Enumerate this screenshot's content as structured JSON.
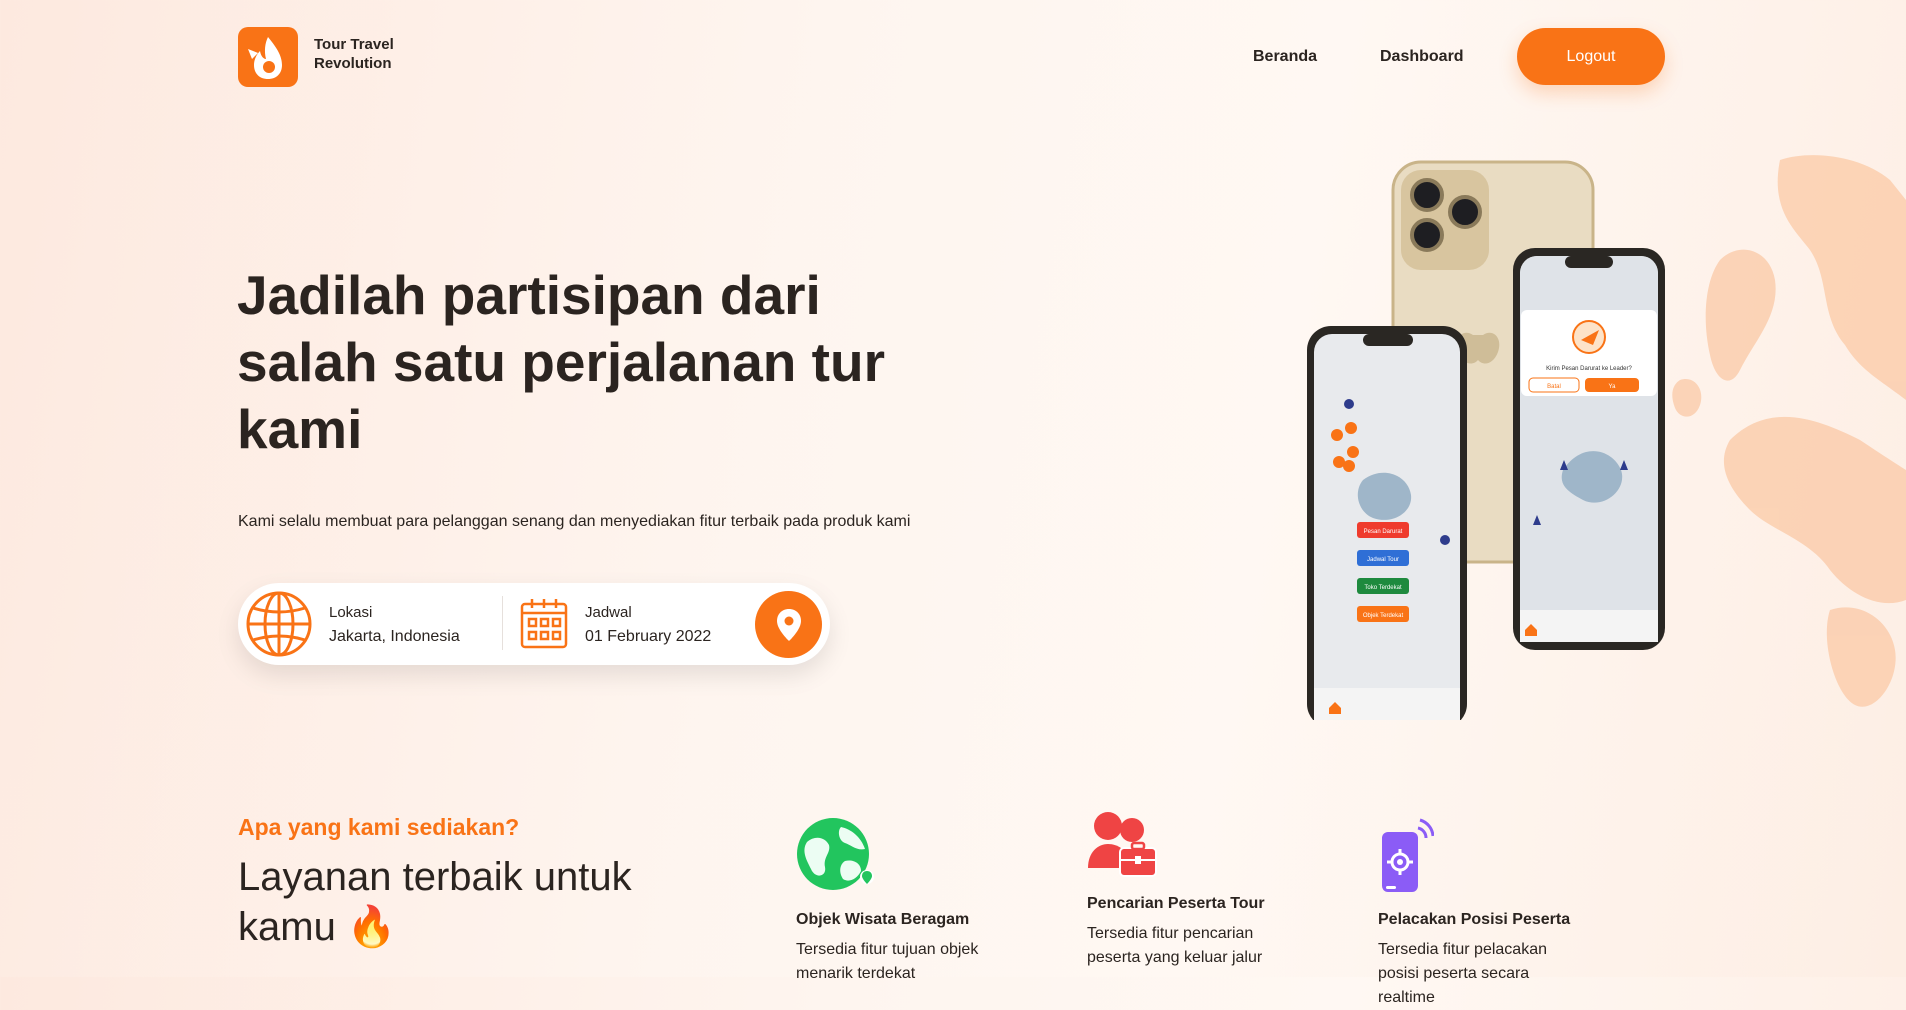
{
  "brand": {
    "line1": "Tour Travel",
    "line2": "Revolution"
  },
  "nav": {
    "beranda": "Beranda",
    "dashboard": "Dashboard",
    "logout": "Logout"
  },
  "hero": {
    "title": "Jadilah partisipan dari salah satu perjalanan tur kami",
    "subtitle": "Kami selalu membuat para pelanggan senang dan menyediakan fitur terbaik pada produk kami"
  },
  "search": {
    "location_label": "Lokasi",
    "location_value": "Jakarta, Indonesia",
    "schedule_label": "Jadwal",
    "schedule_value": "01 February 2022"
  },
  "phone_screens": {
    "dialog_text": "Kirim Pesan Darurat ke Leader?",
    "dialog_cancel": "Batal",
    "dialog_ok": "Ya",
    "menu": [
      "Pesan Darurat",
      "Jadwal Tour",
      "Toko Terdekat",
      "Objek Terdekat"
    ]
  },
  "services": {
    "eyebrow": "Apa yang kami sediakan?",
    "title": "Layanan terbaik untuk kamu 🔥",
    "items": [
      {
        "title": "Objek Wisata Beragam",
        "desc": "Tersedia fitur tujuan objek menarik terdekat"
      },
      {
        "title": "Pencarian Peserta Tour",
        "desc": "Tersedia fitur pencarian peserta yang keluar jalur"
      },
      {
        "title": "Pelacakan Posisi Peserta",
        "desc": "Tersedia fitur pelacakan posisi peserta secara realtime"
      }
    ]
  },
  "colors": {
    "accent": "#f97316",
    "text": "#2b2420",
    "map_blob": "#fbc9a6"
  },
  "icons": [
    "flame-logo-icon",
    "globe-icon",
    "calendar-icon",
    "location-pin-icon",
    "earth-icon",
    "people-icon",
    "phone-tracking-icon"
  ]
}
